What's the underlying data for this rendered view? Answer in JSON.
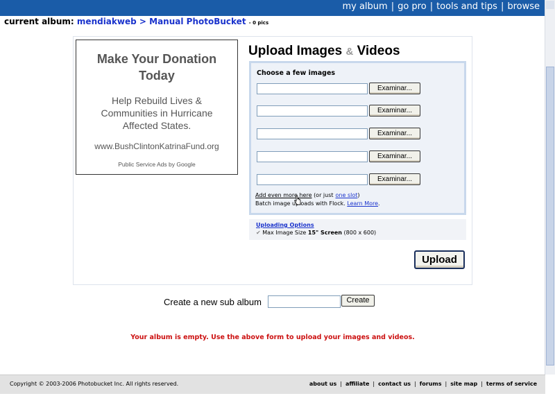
{
  "nav": {
    "items": [
      "my album",
      "go pro",
      "tools and tips",
      "browse"
    ],
    "separator": "|"
  },
  "breadcrumb": {
    "label": "current album:",
    "album": "mendiakweb",
    "arrow": ">",
    "sub": "Manual PhotoBucket",
    "count": "- 0 pics"
  },
  "ad": {
    "title": "Make Your Donation Today",
    "body": "Help Rebuild Lives & Communities in Hurricane Affected States.",
    "url": "www.BushClintonKatrinaFund.org",
    "footer": "Public Service Ads by Google"
  },
  "upload": {
    "title_a": "Upload Images",
    "title_amp": "&",
    "title_b": "Videos",
    "choose_label": "Choose a few images",
    "browse_label": "Examinar...",
    "slots": 5,
    "more_text": "Add even more here",
    "or_just_text": "(or just",
    "one_slot": "one slot",
    "close_paren": ")",
    "flock_text": "Batch image uploads with Flock.",
    "learn_more": "Learn More",
    "learn_more_end": ".",
    "options_head": "Uploading Options",
    "max_size_label": "Max Image Size",
    "max_size_value": "15\" Screen",
    "max_size_dims": "(800 x 600)",
    "upload_button": "Upload"
  },
  "subalbum": {
    "label": "Create a new sub album",
    "button": "Create",
    "value": ""
  },
  "empty_msg": "Your album is empty. Use the above form to upload your images and videos.",
  "footer": {
    "copyright": "Copyright © 2003-2006 Photobucket Inc. All rights reserved.",
    "links": [
      "about us",
      "affiliate",
      "contact us",
      "forums",
      "site map",
      "terms of service"
    ],
    "separator": "|"
  },
  "colors": {
    "topbar": "#1a5ca8",
    "link": "#1a33cc",
    "error": "#cc1111",
    "upload_panel": "#c8d8ec"
  }
}
